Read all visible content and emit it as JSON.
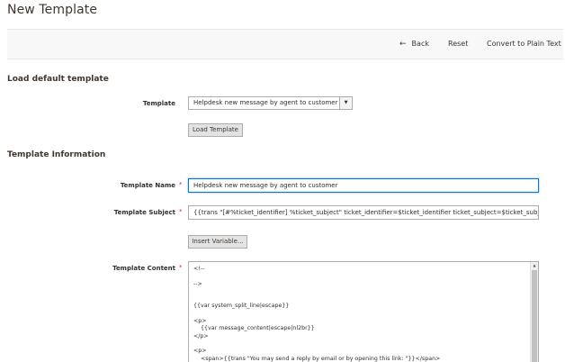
{
  "page": {
    "title": "New Template"
  },
  "actions": {
    "back": "Back",
    "reset": "Reset",
    "convert": "Convert to Plain Text"
  },
  "load_section": {
    "title": "Load default template",
    "template_label": "Template",
    "template_value": "Helpdesk new message by agent to customer",
    "load_button": "Load Template"
  },
  "info_section": {
    "title": "Template Information",
    "name_label": "Template Name",
    "name_value": "Helpdesk new message by agent to customer",
    "subject_label": "Template Subject",
    "subject_value": "{{trans \"[#%ticket_identifier] %ticket_subject\" ticket_identifier=$ticket_identifier ticket_subject=$ticket_subject}}",
    "insert_variable": "Insert Variable...",
    "content_label": "Template Content",
    "content_value": "<!--\n\n-->\n\n\n{{var system_split_line|escape}}\n\n<p>\n    {{var message_content|escape|nl2br}}\n</p>\n\n<p>\n    <span>{{trans \"You may send a reply by email or by opening this link: \"}}</span>\n    <br>"
  },
  "required_mark": "*"
}
